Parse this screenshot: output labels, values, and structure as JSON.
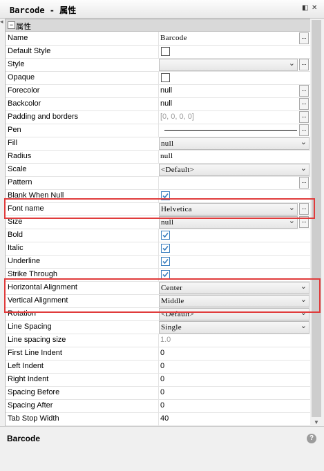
{
  "window": {
    "title": "Barcode - 属性"
  },
  "category": {
    "toggle": "−",
    "label": "属性"
  },
  "rows": [
    {
      "name": "Name",
      "value": "Barcode"
    },
    {
      "name": "Default Style"
    },
    {
      "name": "Style",
      "value": ""
    },
    {
      "name": "Opaque"
    },
    {
      "name": "Forecolor",
      "value": "null"
    },
    {
      "name": "Backcolor",
      "value": "null"
    },
    {
      "name": "Padding and borders",
      "value": "[0, 0, 0, 0]"
    },
    {
      "name": "Pen"
    },
    {
      "name": "Fill",
      "value": "null"
    },
    {
      "name": "Radius",
      "value": "null"
    },
    {
      "name": "Scale",
      "value": "<Default>"
    },
    {
      "name": "Pattern",
      "value": ""
    },
    {
      "name": "Blank When Null"
    },
    {
      "name": "Font name",
      "value": "Helvetica"
    },
    {
      "name": "Size",
      "value": "null"
    },
    {
      "name": "Bold"
    },
    {
      "name": "Italic"
    },
    {
      "name": "Underline"
    },
    {
      "name": "Strike Through"
    },
    {
      "name": "Horizontal Alignment",
      "value": "Center"
    },
    {
      "name": "Vertical Alignment",
      "value": "Middle"
    },
    {
      "name": "Rotation",
      "value": "<Default>"
    },
    {
      "name": "Line Spacing",
      "value": "Single"
    },
    {
      "name": "Line spacing size",
      "value": "1.0"
    },
    {
      "name": "First Line Indent",
      "value": "0"
    },
    {
      "name": "Left Indent",
      "value": "0"
    },
    {
      "name": "Right Indent",
      "value": "0"
    },
    {
      "name": "Spacing Before",
      "value": "0"
    },
    {
      "name": "Spacing After",
      "value": "0"
    },
    {
      "name": "Tab Stop Width",
      "value": "40"
    }
  ],
  "checkboxes": {
    "default_style": false,
    "opaque": false,
    "blank_when_null": true,
    "bold": true,
    "italic": true,
    "underline": true,
    "strike_through": true
  },
  "ellipsis": "...",
  "description": {
    "title": "Barcode",
    "help": "?"
  },
  "colors": {
    "highlight": "#e03b3b",
    "checkbox_accent": "#3a7ebf",
    "category_bg": "#d9d9d9"
  }
}
